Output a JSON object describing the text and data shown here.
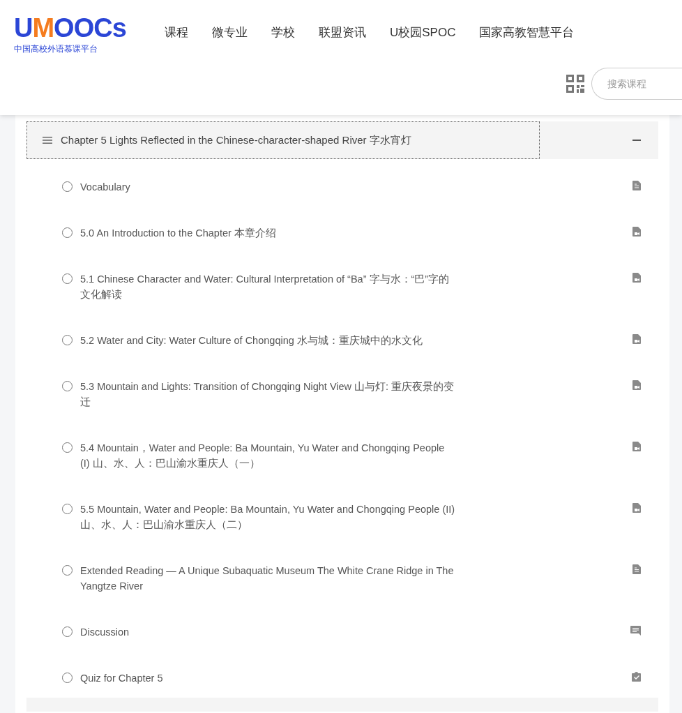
{
  "logo": {
    "parts": [
      {
        "text": "U",
        "color": "#2b46d6"
      },
      {
        "text": "M",
        "color": "#f57c1f"
      },
      {
        "text": "OOCs",
        "color": "#2b46d6"
      }
    ],
    "subtitle": "中国高校外语慕课平台"
  },
  "nav": [
    "课程",
    "微专业",
    "学校",
    "联盟资讯",
    "U校园SPOC",
    "国家高教智慧平台"
  ],
  "search": {
    "placeholder": "搜索课程"
  },
  "chapter": {
    "title": "Chapter 5 Lights Reflected in the Chinese-character-shaped River 字水宵灯",
    "expanded": true,
    "items": [
      {
        "title": "Vocabulary",
        "kind": "document",
        "completed": false
      },
      {
        "title": "5.0 An Introduction to the Chapter 本章介绍",
        "kind": "video",
        "completed": false
      },
      {
        "title": "5.1 Chinese Character and Water: Cultural Interpretation of “Ba” 字与水：“巴”字的文化解读",
        "kind": "video",
        "completed": false
      },
      {
        "title": "5.2 Water and City: Water Culture of Chongqing 水与城：重庆城中的水文化",
        "kind": "video",
        "completed": false
      },
      {
        "title": "5.3 Mountain and Lights: Transition of Chongqing Night View 山与灯: 重庆夜景的变迁",
        "kind": "video",
        "completed": false
      },
      {
        "title": "5.4 Mountain，Water and People: Ba Mountain, Yu Water and Chongqing People (I) 山、水、人：巴山渝水重庆人（一）",
        "kind": "video",
        "completed": false
      },
      {
        "title": "5.5 Mountain, Water and People: Ba Mountain, Yu Water and Chongqing People (II) 山、水、人：巴山渝水重庆人（二）",
        "kind": "video",
        "completed": false
      },
      {
        "title": "Extended Reading — A Unique Subaquatic Museum The White Crane Ridge in The Yangtze River",
        "kind": "document",
        "completed": false
      },
      {
        "title": "Discussion",
        "kind": "discussion",
        "completed": false
      },
      {
        "title": "Quiz for Chapter 5",
        "kind": "quiz",
        "completed": false
      }
    ]
  }
}
